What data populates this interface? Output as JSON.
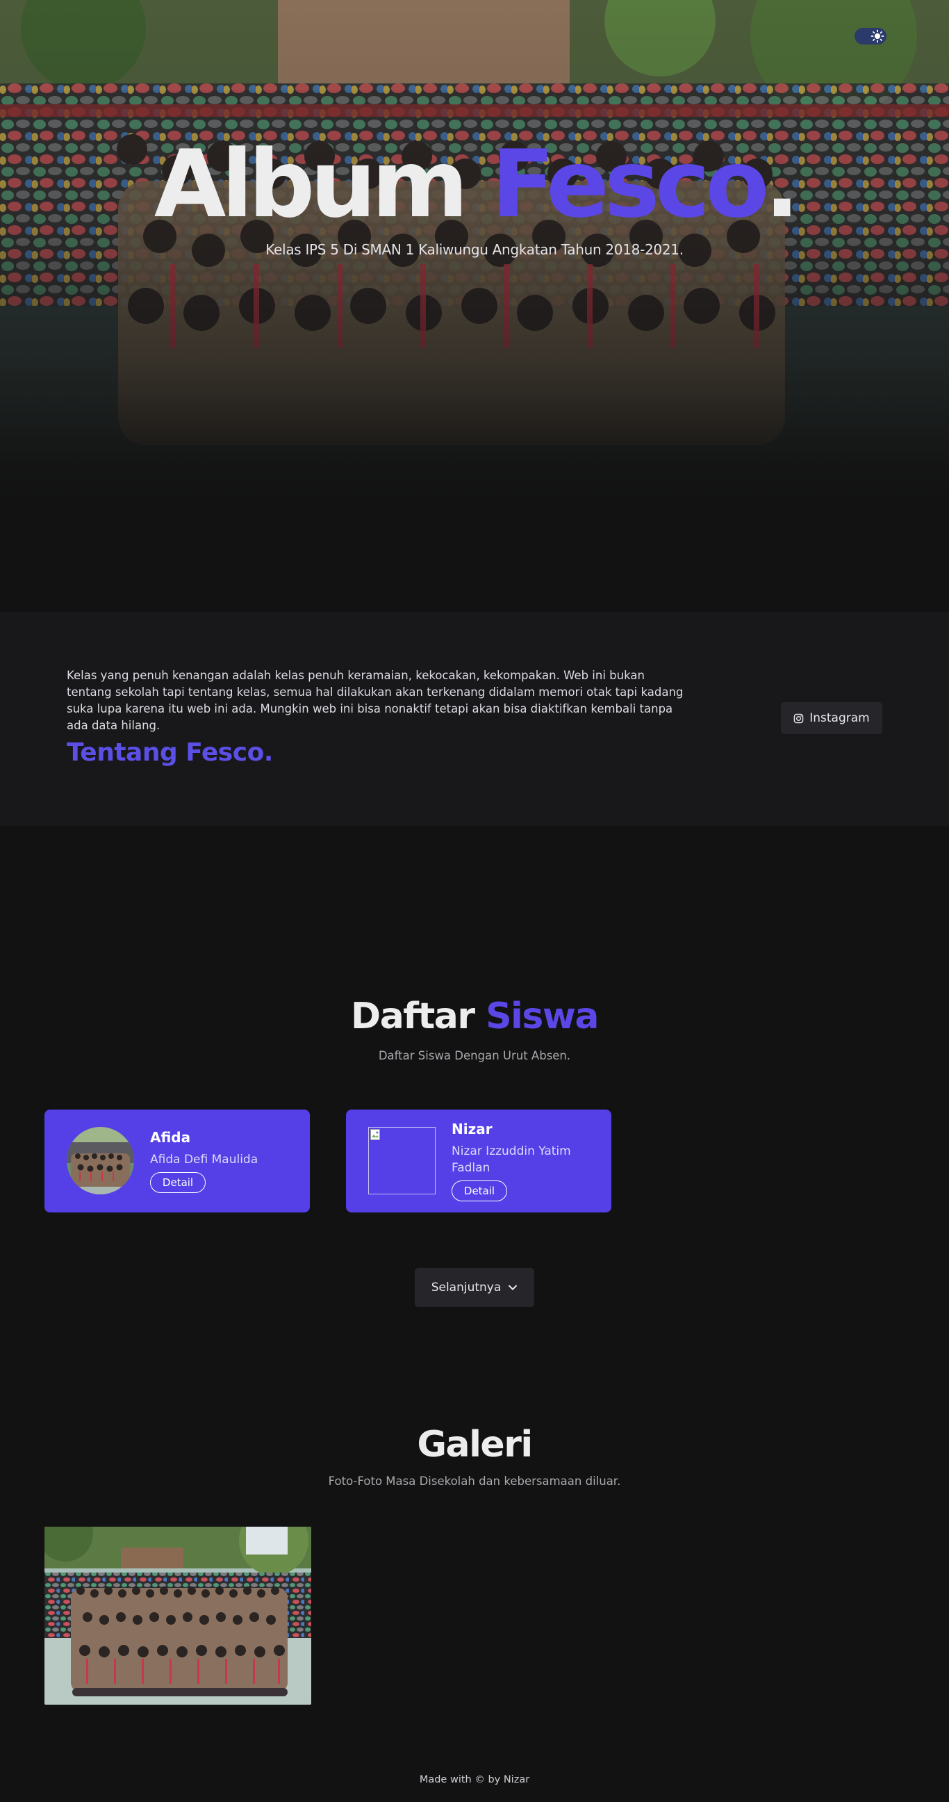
{
  "theme_toggle": {
    "icon": "sun-icon"
  },
  "hero": {
    "title_main": "Album ",
    "title_accent": "Fesco",
    "title_dot": ".",
    "subtitle": "Kelas IPS 5 Di SMAN 1 Kaliwungu Angkatan Tahun 2018-2021."
  },
  "about": {
    "text": "Kelas yang penuh kenangan adalah kelas penuh keramaian, kekocakan, kekompakan. Web ini bukan tentang sekolah tapi tentang kelas, semua hal dilakukan akan terkenang didalam memori otak tapi kadang suka lupa karena itu web ini ada. Mungkin web ini bisa nonaktif tetapi akan bisa diaktifkan kembali tanpa ada data hilang.",
    "heading": "Tentang Fesco.",
    "instagram_label": "Instagram",
    "instagram_icon": "instagram-icon"
  },
  "students": {
    "title_main": "Daftar ",
    "title_accent": "Siswa",
    "subtitle": "Daftar Siswa Dengan Urut Absen.",
    "cards": [
      {
        "name": "Afida",
        "full_name": "Afida Defi Maulida",
        "detail_label": "Detail"
      },
      {
        "name": "Nizar",
        "full_name": "Nizar Izzuddin Yatim Fadlan",
        "detail_label": "Detail"
      }
    ],
    "next_label": "Selanjutnya",
    "next_icon": "chevron-down-icon"
  },
  "gallery": {
    "title": "Galeri",
    "subtitle": "Foto-Foto Masa Disekolah dan kebersamaan diluar."
  },
  "footer": {
    "text": "Made with © by Nizar"
  },
  "colors": {
    "background": "#121212",
    "section_background": "#18181b",
    "accent": "#5440e6",
    "button": "#26262a"
  }
}
